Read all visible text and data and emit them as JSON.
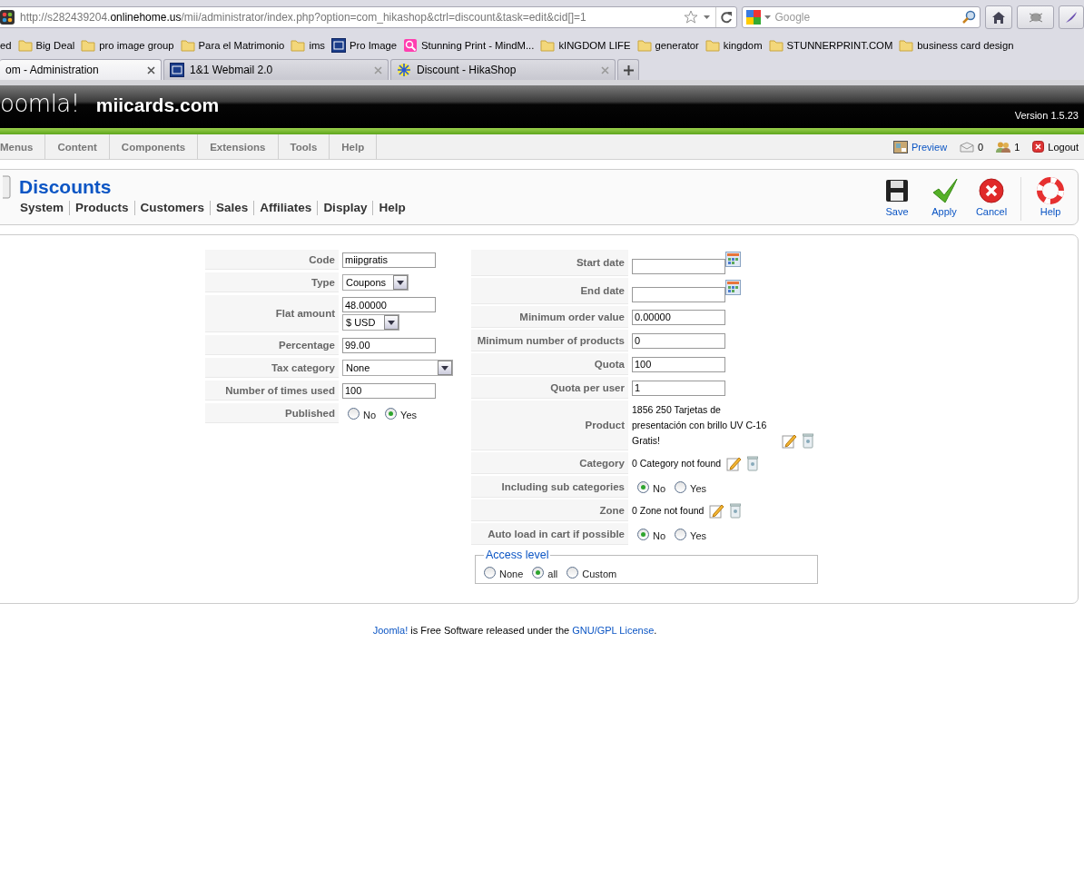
{
  "browser": {
    "url": "http://s282439204.**onlinehome.us**/mii/administrator/index.php?option=com_hikashop&ctrl=discount&task=edit&cid[]=1",
    "search_placeholder": "Google",
    "bookmarks": [
      {
        "label": "ed",
        "kind": "none"
      },
      {
        "label": "Big Deal",
        "kind": "folder"
      },
      {
        "label": "pro image group",
        "kind": "folder"
      },
      {
        "label": "Para el Matrimonio",
        "kind": "folder"
      },
      {
        "label": "ims",
        "kind": "folder"
      },
      {
        "label": "Pro Image",
        "kind": "site"
      },
      {
        "label": "Stunning Print - MindM...",
        "kind": "app"
      },
      {
        "label": "kINGDOM LIFE",
        "kind": "folder"
      },
      {
        "label": "generator",
        "kind": "folder"
      },
      {
        "label": "kingdom",
        "kind": "folder"
      },
      {
        "label": "STUNNERPRINT.COM",
        "kind": "folder"
      },
      {
        "label": "business card design",
        "kind": "folder"
      }
    ],
    "tabs": [
      {
        "title": "om - Administration",
        "selected": true
      },
      {
        "title": "1&1 Webmail 2.0",
        "selected": false
      },
      {
        "title": "Discount - HikaShop",
        "selected": false
      }
    ]
  },
  "header": {
    "logo": "oomla!",
    "site": "miicards.com",
    "version": "Version 1.5.23"
  },
  "menu": [
    "Menus",
    "Content",
    "Components",
    "Extensions",
    "Tools",
    "Help"
  ],
  "status": {
    "preview": "Preview",
    "messages": "0",
    "users": "1",
    "logout": "Logout"
  },
  "toolbar": {
    "title": "Discounts",
    "submenu": [
      "System",
      "Products",
      "Customers",
      "Sales",
      "Affiliates",
      "Display",
      "Help"
    ],
    "buttons": [
      {
        "label": "Save",
        "kind": "save"
      },
      {
        "label": "Apply",
        "kind": "apply"
      },
      {
        "label": "Cancel",
        "kind": "cancel"
      },
      {
        "label": "Help",
        "kind": "help"
      }
    ]
  },
  "left_fields": [
    {
      "kind": "text",
      "label": "Code",
      "value": "miipgratis"
    },
    {
      "kind": "select",
      "label": "Type",
      "value": "Coupons"
    },
    {
      "kind": "amount",
      "label": "Flat amount",
      "value": "48.00000",
      "currency": "$ USD"
    },
    {
      "kind": "text",
      "label": "Percentage",
      "value": "99.00"
    },
    {
      "kind": "wideselect",
      "label": "Tax category",
      "value": "None"
    },
    {
      "kind": "text",
      "label": "Number of times used",
      "value": "100"
    },
    {
      "kind": "radio",
      "label": "Published",
      "options": [
        {
          "label": "No",
          "selected": false
        },
        {
          "label": "Yes",
          "selected": true
        }
      ]
    }
  ],
  "right_fields": [
    {
      "kind": "date",
      "label": "Start date"
    },
    {
      "kind": "date",
      "label": "End date"
    },
    {
      "kind": "text",
      "label": "Minimum order value",
      "value": "0.00000"
    },
    {
      "kind": "text",
      "label": "Minimum number of products",
      "value": "0"
    },
    {
      "kind": "text",
      "label": "Quota",
      "value": "100"
    },
    {
      "kind": "text",
      "label": "Quota per user",
      "value": "1"
    },
    {
      "kind": "item",
      "label": "Product",
      "text": "1856 250 Tarjetas de presentación con brillo UV C-16 Gratis!"
    },
    {
      "kind": "item",
      "label": "Category",
      "text": "0 Category not found"
    },
    {
      "kind": "radio",
      "label": "Including sub categories",
      "options": [
        {
          "label": "No",
          "selected": true
        },
        {
          "label": "Yes",
          "selected": false
        }
      ]
    },
    {
      "kind": "item",
      "label": "Zone",
      "text": "0 Zone not found"
    },
    {
      "kind": "radio",
      "label": "Auto load in cart if possible",
      "options": [
        {
          "label": "No",
          "selected": true
        },
        {
          "label": "Yes",
          "selected": false
        }
      ]
    }
  ],
  "access_level": {
    "legend": "Access level",
    "options": [
      {
        "label": "None",
        "selected": false
      },
      {
        "label": "all",
        "selected": true
      },
      {
        "label": "Custom",
        "selected": false
      }
    ]
  },
  "footer": {
    "link1": "Joomla!",
    "text": " is Free Software released under the ",
    "link2": "GNU/GPL License",
    "end": "."
  }
}
